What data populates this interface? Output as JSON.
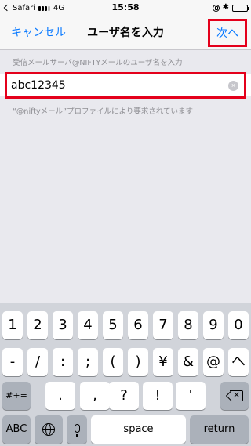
{
  "status_bar": {
    "app": "Safari",
    "network": "4G",
    "time": "15:58",
    "bluetooth": "✱",
    "battery_level": 1.0
  },
  "navbar": {
    "cancel": "キャンセル",
    "title": "ユーザ名を入力",
    "next": "次へ"
  },
  "form": {
    "header": "受信メールサーバ@NIFTYメールのユーザ名を入力",
    "username_value": "abc12345",
    "clear_icon": "×",
    "footer": "“@niftyメール”プロファイルにより要求されています"
  },
  "keyboard": {
    "row1": [
      "1",
      "2",
      "3",
      "4",
      "5",
      "6",
      "7",
      "8",
      "9",
      "0"
    ],
    "row2": [
      "-",
      "/",
      ":",
      ";",
      "(",
      ")",
      "¥",
      "&",
      "@",
      "へ"
    ],
    "row3_toggle": "#+=",
    "row3": [
      ".",
      ",",
      "?",
      "!",
      "'"
    ],
    "abc": "ABC",
    "space": "space",
    "return": "return"
  },
  "colors": {
    "accent": "#0a7aff",
    "highlight": "#e4001b",
    "background": "#e9e9ee",
    "keyboard": "#d1d4da"
  }
}
